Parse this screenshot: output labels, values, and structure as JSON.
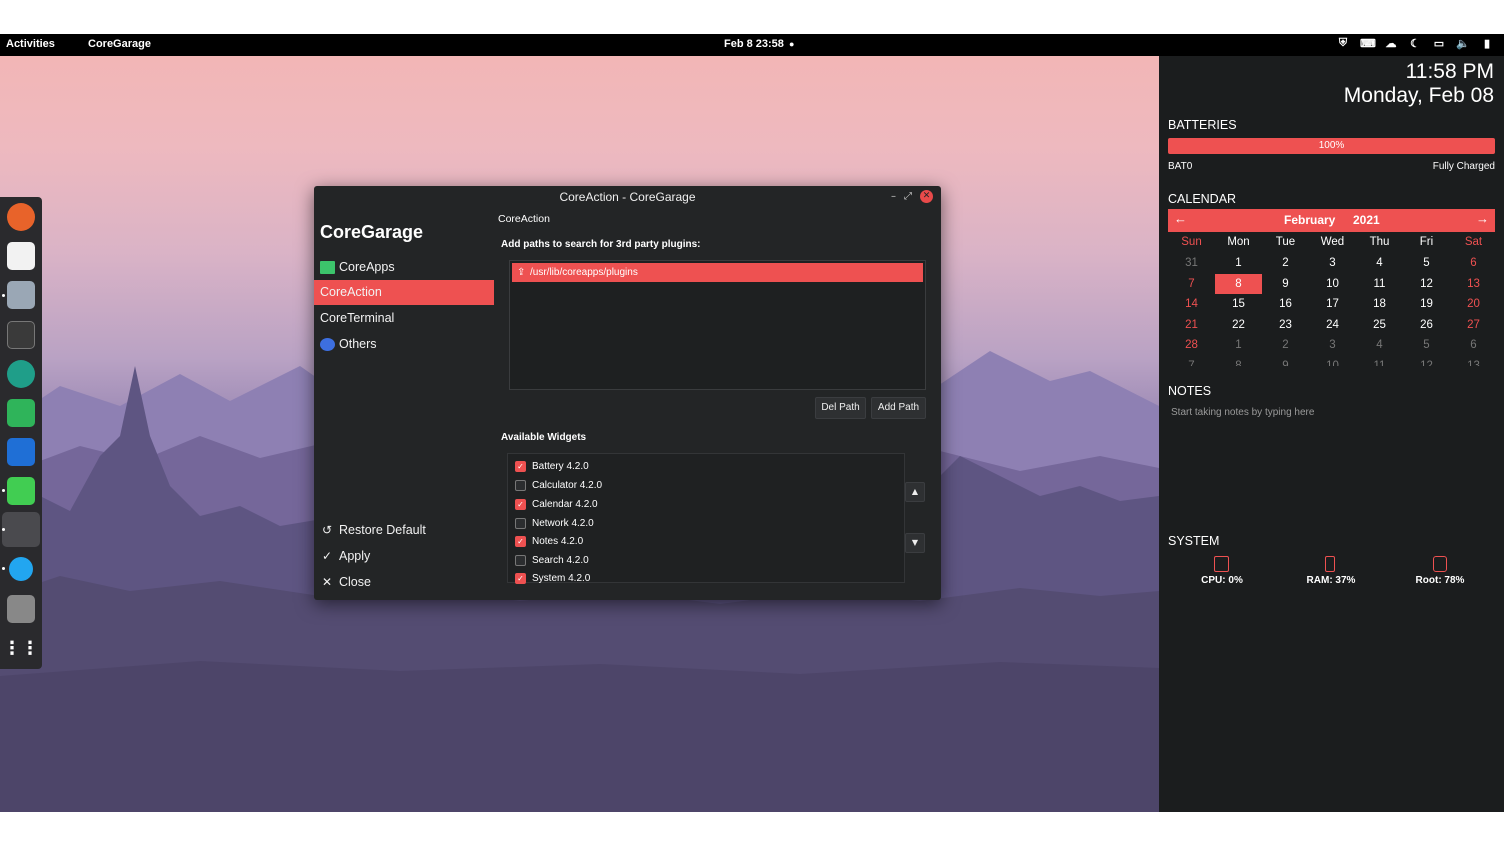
{
  "topbar": {
    "activities": "Activities",
    "app": "CoreGarage",
    "datetime": "Feb 8  23:58",
    "dot": "●",
    "tray_icons": [
      "shield-icon",
      "keyboard-icon",
      "cloud-icon",
      "night-mode-icon",
      "screen-icon",
      "volume-icon",
      "battery-icon"
    ],
    "tray_glyphs": [
      "⛨",
      "⌨",
      "☁",
      "☾",
      "▭",
      "🔈",
      "▮"
    ]
  },
  "dock": {
    "items": [
      "firefox",
      "text-editor",
      "archive-manager",
      "terminal",
      "screenshot",
      "coreapps",
      "coregarage-blue",
      "qt-creator",
      "active-window",
      "messages",
      "trash",
      "app-grid"
    ]
  },
  "window": {
    "title": "CoreAction - CoreGarage",
    "controls": {
      "minimize": "–",
      "restore": "⤢",
      "close": "✕"
    },
    "app_name": "CoreGarage",
    "nav": [
      {
        "label": "CoreApps",
        "icon": "coreapps-icon"
      },
      {
        "label": "CoreAction",
        "icon": ""
      },
      {
        "label": "CoreTerminal",
        "icon": ""
      },
      {
        "label": "Others",
        "icon": "others-icon"
      }
    ],
    "actions": [
      {
        "label": "Restore Default",
        "glyph": "↺"
      },
      {
        "label": "Apply",
        "glyph": "✓"
      },
      {
        "label": "Close",
        "glyph": "✕"
      }
    ],
    "page_label": "CoreAction",
    "paths_heading": "Add paths to search for 3rd party plugins:",
    "paths": [
      "/usr/lib/coreapps/plugins"
    ],
    "del_path": "Del Path",
    "add_path": "Add Path",
    "widgets_heading": "Available Widgets",
    "widgets": [
      {
        "label": "Battery 4.2.0",
        "checked": true
      },
      {
        "label": "Calculator 4.2.0",
        "checked": false
      },
      {
        "label": "Calendar 4.2.0",
        "checked": true
      },
      {
        "label": "Network 4.2.0",
        "checked": false
      },
      {
        "label": "Notes 4.2.0",
        "checked": true
      },
      {
        "label": "Search 4.2.0",
        "checked": false
      },
      {
        "label": "System 4.2.0",
        "checked": true
      }
    ],
    "move_up": "▲",
    "move_down": "▼"
  },
  "panel": {
    "time": "11:58 PM",
    "date": "Monday, Feb 08",
    "batteries_heading": "BATTERIES",
    "battery_level": "100%",
    "battery_name": "BAT0",
    "battery_status": "Fully Charged",
    "calendar_heading": "CALENDAR",
    "month": "February",
    "year": "2021",
    "prev": "←",
    "next": "→",
    "weekdays": [
      "Sun",
      "Mon",
      "Tue",
      "Wed",
      "Thu",
      "Fri",
      "Sat"
    ],
    "weeks": [
      [
        "31",
        "1",
        "2",
        "3",
        "4",
        "5",
        "6"
      ],
      [
        "7",
        "8",
        "9",
        "10",
        "11",
        "12",
        "13"
      ],
      [
        "14",
        "15",
        "16",
        "17",
        "18",
        "19",
        "20"
      ],
      [
        "21",
        "22",
        "23",
        "24",
        "25",
        "26",
        "27"
      ],
      [
        "28",
        "1",
        "2",
        "3",
        "4",
        "5",
        "6"
      ],
      [
        "7",
        "8",
        "9",
        "10",
        "11",
        "12",
        "13"
      ]
    ],
    "today": "8",
    "notes_heading": "NOTES",
    "notes_placeholder": "Start taking notes by typing here",
    "system_heading": "SYSTEM",
    "system": [
      {
        "label": "CPU: 0%",
        "icon": "cpu-icon"
      },
      {
        "label": "RAM: 37%",
        "icon": "ram-icon"
      },
      {
        "label": "Root: 78%",
        "icon": "disk-icon"
      }
    ]
  }
}
